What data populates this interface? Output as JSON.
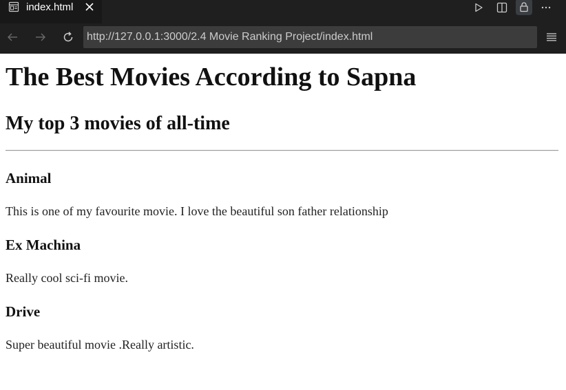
{
  "tab": {
    "title": "index.html",
    "icon": "preview-page-icon"
  },
  "toolbar": {
    "icons": [
      "run-icon",
      "split-editor-icon",
      "lock-icon",
      "more-icon"
    ]
  },
  "navigation": {
    "back_icon": "arrow-left-icon",
    "forward_icon": "arrow-right-icon",
    "reload_icon": "reload-icon",
    "menu_icon": "hamburger-menu-icon",
    "url": "http://127.0.0.1:3000/2.4 Movie Ranking Project/index.html"
  },
  "page": {
    "heading": "The Best Movies According to Sapna",
    "subheading": "My top 3 movies of all-time",
    "movies": [
      {
        "title": "Animal",
        "description": "This is one of my favourite movie. I love the beautiful son father relationship"
      },
      {
        "title": "Ex Machina",
        "description": "Really cool sci-fi movie."
      },
      {
        "title": "Drive",
        "description": "Super beautiful movie .Really artistic."
      }
    ]
  },
  "colors": {
    "chrome_bg": "#1f1f1f",
    "url_bg": "#3c3c3c",
    "page_bg": "#ffffff"
  }
}
